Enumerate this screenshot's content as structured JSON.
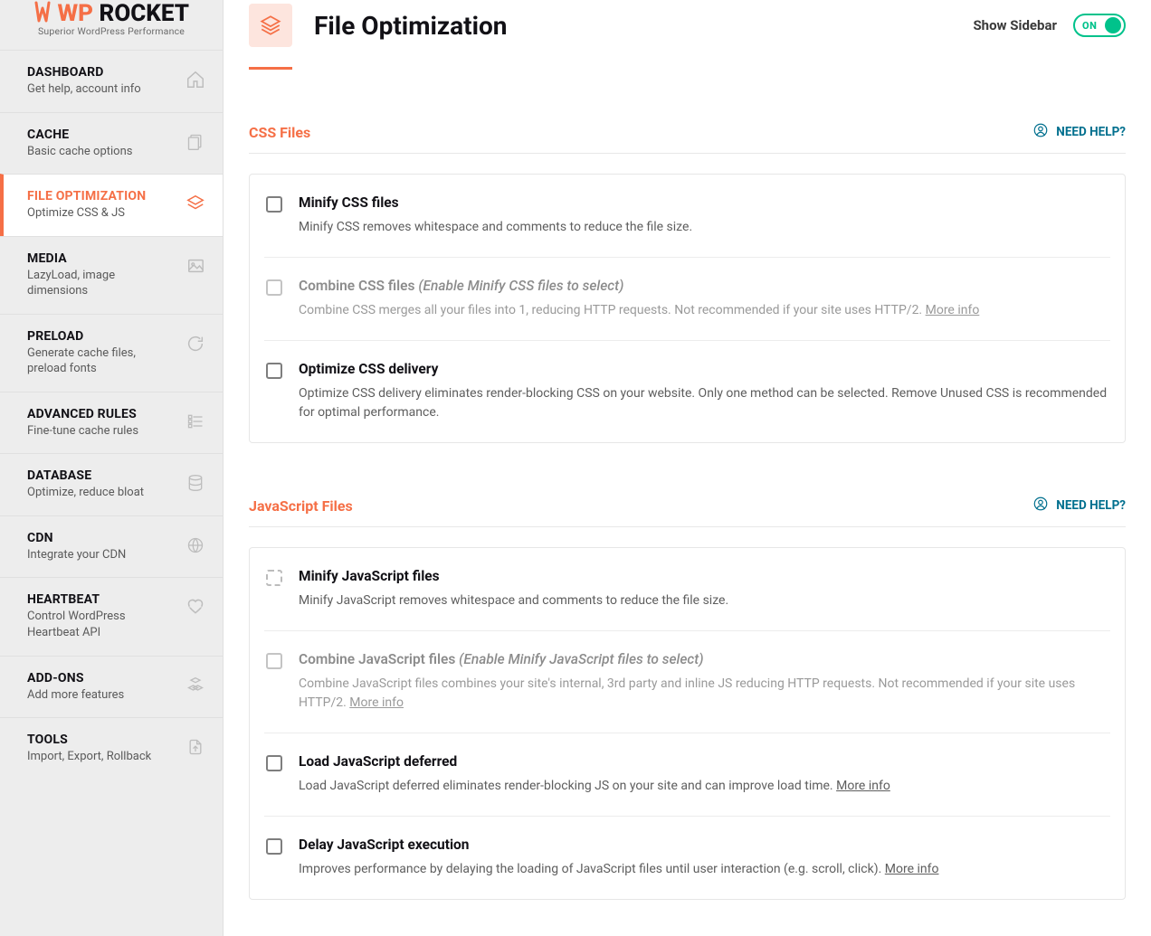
{
  "brand": {
    "wp": "WP",
    "rocket": " ROCKET",
    "sub": "Superior WordPress Performance"
  },
  "header": {
    "title": "File Optimization",
    "show_sidebar": "Show Sidebar",
    "toggle_on": "ON"
  },
  "nav": [
    {
      "title": "DASHBOARD",
      "desc": "Get help, account info"
    },
    {
      "title": "CACHE",
      "desc": "Basic cache options"
    },
    {
      "title": "FILE OPTIMIZATION",
      "desc": "Optimize CSS & JS"
    },
    {
      "title": "MEDIA",
      "desc": "LazyLoad, image dimensions"
    },
    {
      "title": "PRELOAD",
      "desc": "Generate cache files, preload fonts"
    },
    {
      "title": "ADVANCED RULES",
      "desc": "Fine-tune cache rules"
    },
    {
      "title": "DATABASE",
      "desc": "Optimize, reduce bloat"
    },
    {
      "title": "CDN",
      "desc": "Integrate your CDN"
    },
    {
      "title": "HEARTBEAT",
      "desc": "Control WordPress Heartbeat API"
    },
    {
      "title": "ADD-ONS",
      "desc": "Add more features"
    },
    {
      "title": "TOOLS",
      "desc": "Import, Export, Rollback"
    }
  ],
  "css": {
    "section_title": "CSS Files",
    "need_help": "NEED HELP?",
    "minify_label": "Minify CSS files",
    "minify_desc": "Minify CSS removes whitespace and comments to reduce the file size.",
    "combine_label": "Combine CSS files ",
    "combine_hint": "(Enable Minify CSS files to select)",
    "combine_desc": "Combine CSS merges all your files into 1, reducing HTTP requests. Not recommended if your site uses HTTP/2. ",
    "more_info": "More info",
    "optimize_label": "Optimize CSS delivery",
    "optimize_desc": "Optimize CSS delivery eliminates render-blocking CSS on your website. Only one method can be selected. Remove Unused CSS is recommended for optimal performance."
  },
  "js": {
    "section_title": "JavaScript Files",
    "need_help": "NEED HELP?",
    "minify_label": "Minify JavaScript files",
    "minify_desc": "Minify JavaScript removes whitespace and comments to reduce the file size.",
    "combine_label": "Combine JavaScript files ",
    "combine_hint": "(Enable Minify JavaScript files to select)",
    "combine_desc": "Combine JavaScript files combines your site's internal, 3rd party and inline JS reducing HTTP requests. Not recommended if your site uses HTTP/2. ",
    "more_info": "More info",
    "defer_label": "Load JavaScript deferred",
    "defer_desc": "Load JavaScript deferred eliminates render-blocking JS on your site and can improve load time. ",
    "delay_label": "Delay JavaScript execution",
    "delay_desc": "Improves performance by delaying the loading of JavaScript files until user interaction (e.g. scroll, click). "
  }
}
